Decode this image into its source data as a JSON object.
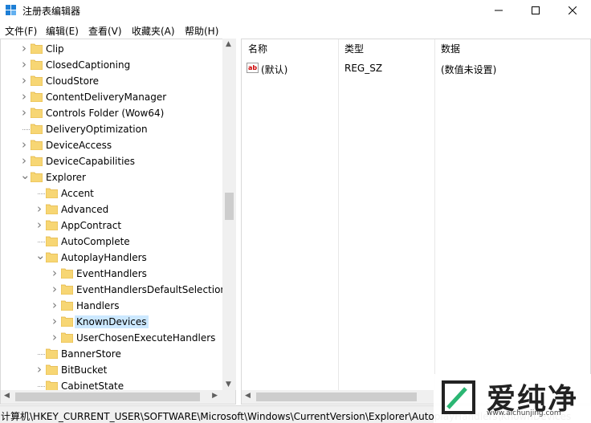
{
  "window": {
    "title": "注册表编辑器",
    "icon": "regedit-icon"
  },
  "menu": [
    "文件(F)",
    "编辑(E)",
    "查看(V)",
    "收藏夹(A)",
    "帮助(H)"
  ],
  "tree": [
    {
      "label": "Clip",
      "level": 0,
      "expand": ">"
    },
    {
      "label": "ClosedCaptioning",
      "level": 0,
      "expand": ">"
    },
    {
      "label": "CloudStore",
      "level": 0,
      "expand": ">"
    },
    {
      "label": "ContentDeliveryManager",
      "level": 0,
      "expand": ">"
    },
    {
      "label": "Controls Folder (Wow64)",
      "level": 0,
      "expand": ">"
    },
    {
      "label": "DeliveryOptimization",
      "level": 0,
      "expand": ""
    },
    {
      "label": "DeviceAccess",
      "level": 0,
      "expand": ">"
    },
    {
      "label": "DeviceCapabilities",
      "level": 0,
      "expand": ">"
    },
    {
      "label": "Explorer",
      "level": 0,
      "expand": "v"
    },
    {
      "label": "Accent",
      "level": 1,
      "expand": ""
    },
    {
      "label": "Advanced",
      "level": 1,
      "expand": ">"
    },
    {
      "label": "AppContract",
      "level": 1,
      "expand": ">"
    },
    {
      "label": "AutoComplete",
      "level": 1,
      "expand": ""
    },
    {
      "label": "AutoplayHandlers",
      "level": 1,
      "expand": "v"
    },
    {
      "label": "EventHandlers",
      "level": 2,
      "expand": ">"
    },
    {
      "label": "EventHandlersDefaultSelection",
      "level": 2,
      "expand": ">"
    },
    {
      "label": "Handlers",
      "level": 2,
      "expand": ">"
    },
    {
      "label": "KnownDevices",
      "level": 2,
      "expand": ">",
      "selected": true
    },
    {
      "label": "UserChosenExecuteHandlers",
      "level": 2,
      "expand": ">"
    },
    {
      "label": "BannerStore",
      "level": 1,
      "expand": ""
    },
    {
      "label": "BitBucket",
      "level": 1,
      "expand": ">"
    },
    {
      "label": "CabinetState",
      "level": 1,
      "expand": ""
    }
  ],
  "list": {
    "columns": [
      "名称",
      "类型",
      "数据"
    ],
    "rows": [
      {
        "name": "(默认)",
        "type": "REG_SZ",
        "data": "(数值未设置)",
        "icon": "ab"
      }
    ]
  },
  "status": {
    "path": "计算机\\HKEY_CURRENT_USER\\SOFTWARE\\Microsoft\\Windows\\CurrentVersion\\Explorer\\AutoplayHandlers\\KnownDevices"
  },
  "watermark": {
    "text": "爱纯净",
    "url": "www.aichunjing.com"
  }
}
